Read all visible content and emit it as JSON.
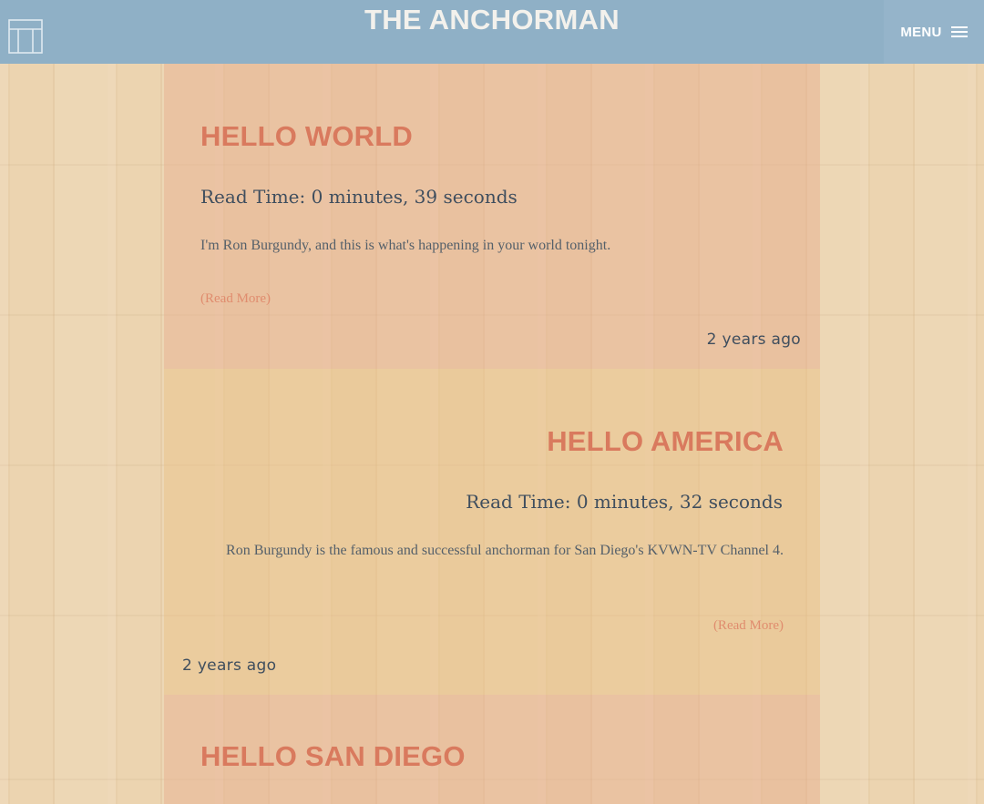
{
  "site": {
    "title": "THE ANCHORMAN",
    "logo_icon": "window-layout-icon"
  },
  "menu": {
    "label": "MENU",
    "icon": "hamburger-icon"
  },
  "colors": {
    "topbar": "#8fb0c6",
    "menu_button": "#95b4ca",
    "title_accent": "#d97a5e",
    "text_dark": "#3f4e5e",
    "link": "#e08c6e"
  },
  "posts": [
    {
      "title": "HELLO WORLD",
      "read_time": "Read Time: 0 minutes, 39 seconds",
      "excerpt": "I'm Ron Burgundy, and this is what's happening in your world tonight.",
      "read_more": "(Read More)",
      "time_ago": "2 years ago"
    },
    {
      "title": "HELLO AMERICA",
      "read_time": "Read Time: 0 minutes, 32 seconds",
      "excerpt": "Ron Burgundy is the famous and successful anchorman for San Diego's KVWN-TV Channel 4.",
      "read_more": "(Read More)",
      "time_ago": "2 years ago"
    },
    {
      "title": "HELLO SAN DIEGO"
    }
  ]
}
